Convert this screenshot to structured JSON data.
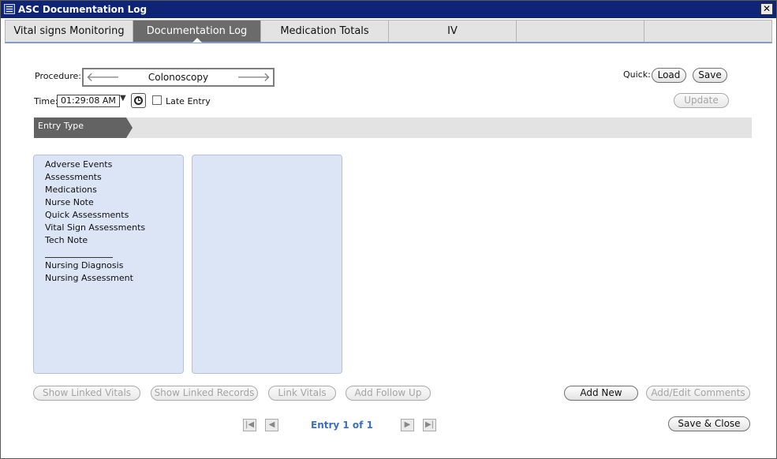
{
  "window": {
    "title": "ASC Documentation Log",
    "close_label": "✕"
  },
  "tabs": [
    {
      "label": "Vital signs Monitoring"
    },
    {
      "label": "Documentation Log",
      "active": true
    },
    {
      "label": "Medication Totals"
    },
    {
      "label": "IV"
    },
    {
      "label": ""
    },
    {
      "label": ""
    }
  ],
  "procedure": {
    "label": "Procedure:",
    "value": "Colonoscopy",
    "prev_icon": "left-arrow-icon",
    "next_icon": "right-arrow-icon"
  },
  "time": {
    "label": "Time:",
    "value": "01:29:08 AM",
    "late_entry_label": "Late Entry",
    "late_entry_checked": false
  },
  "quick": {
    "label": "Quick:",
    "load_label": "Load",
    "save_label": "Save",
    "update_label": "Update"
  },
  "entry_type_label": "Entry Type",
  "entry_types": [
    "Adverse Events",
    "Assessments",
    "Medications",
    "Nurse Note",
    "Quick Assessments",
    "Vital Sign Assessments",
    "Tech Note"
  ],
  "entry_types_extra": [
    "Nursing Diagnosis",
    "Nursing Assessment"
  ],
  "actions": {
    "show_linked_vitals": "Show Linked Vitals",
    "show_linked_records": "Show Linked Records",
    "link_vitals": "Link Vitals",
    "add_follow_up": "Add Follow Up",
    "add_new": "Add New",
    "add_edit_comments": "Add/Edit Comments",
    "save_close": "Save & Close"
  },
  "pager": {
    "text": "Entry 1 of 1"
  }
}
